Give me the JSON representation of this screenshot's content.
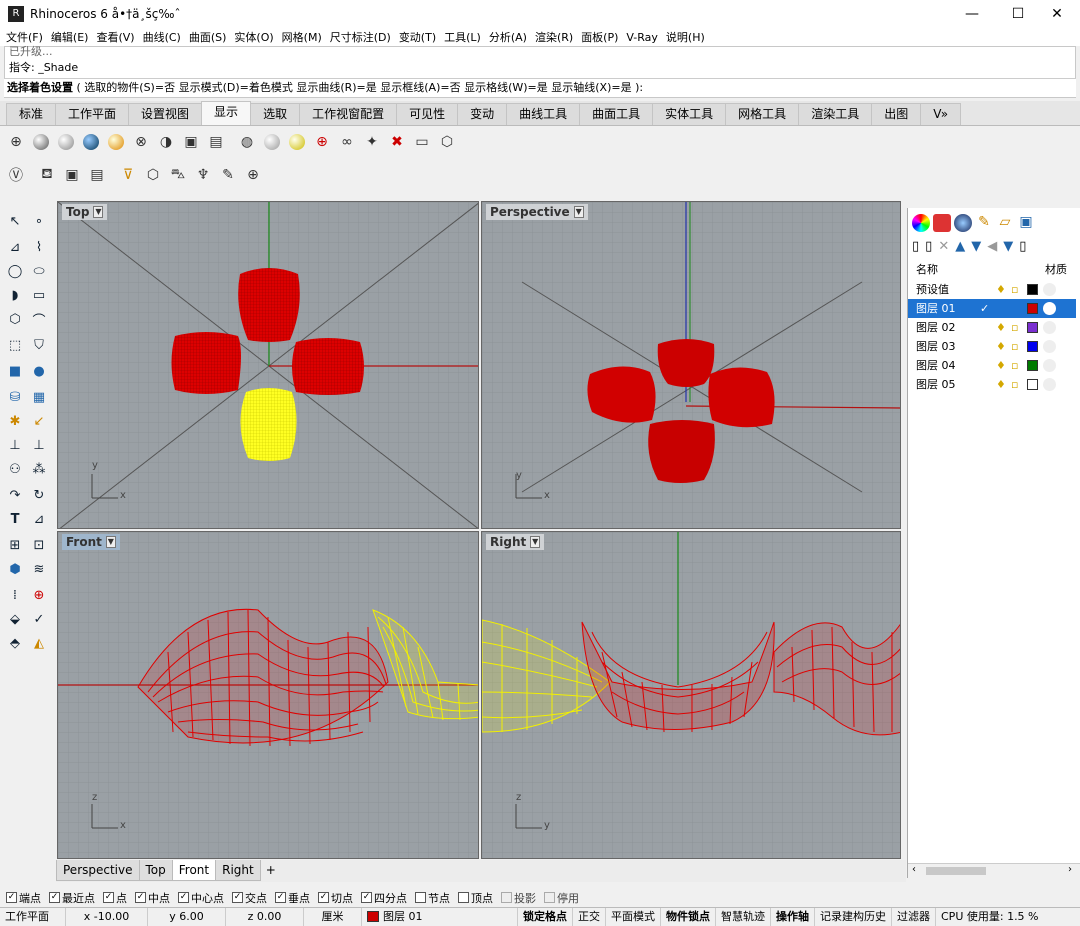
{
  "window": {
    "title": "Rhinoceros 6 å•†ä¸šç‰ˆ",
    "min": "—",
    "max": "☐",
    "close": "✕"
  },
  "menu": [
    "文件(F)",
    "编辑(E)",
    "查看(V)",
    "曲线(C)",
    "曲面(S)",
    "实体(O)",
    "网格(M)",
    "尺寸标注(D)",
    "变动(T)",
    "工具(L)",
    "分析(A)",
    "渲染(R)",
    "面板(P)",
    "V-Ray",
    "说明(H)"
  ],
  "command": {
    "history_partial": "已升级...",
    "history": "指令: _Shade",
    "prompt_label": "选择着色设置",
    "prompt_rest": " ( 选取的物件(S)=否  显示模式(D)=着色模式  显示曲线(R)=是  显示框线(A)=否  显示格线(W)=是  显示轴线(X)=是 ):"
  },
  "tabs": [
    "标准",
    "工作平面",
    "设置视图",
    "显示",
    "选取",
    "工作视窗配置",
    "可见性",
    "变动",
    "曲线工具",
    "曲面工具",
    "实体工具",
    "网格工具",
    "渲染工具",
    "出图",
    "V»"
  ],
  "active_tab": "显示",
  "viewports": {
    "top": {
      "label": "Top",
      "x": "x",
      "y": "y"
    },
    "perspective": {
      "label": "Perspective",
      "x": "x",
      "y": "y"
    },
    "front": {
      "label": "Front",
      "x": "x",
      "y": "z"
    },
    "right": {
      "label": "Right",
      "x": "y",
      "y": "z"
    }
  },
  "viewport_tabs": [
    "Perspective",
    "Top",
    "Front",
    "Right"
  ],
  "viewport_tabs_add": "+",
  "layers": {
    "header_name": "名称",
    "header_material": "材质",
    "rows": [
      {
        "name": "预设值",
        "color": "#000000"
      },
      {
        "name": "图层 01",
        "color": "#cc0000",
        "check": "✓"
      },
      {
        "name": "图层 02",
        "color": "#7a2fd0"
      },
      {
        "name": "图层 03",
        "color": "#0000ee"
      },
      {
        "name": "图层 04",
        "color": "#007a00"
      },
      {
        "name": "图层 05",
        "color": "#ffffff"
      }
    ]
  },
  "osnaps": [
    {
      "label": "端点",
      "on": true
    },
    {
      "label": "最近点",
      "on": true
    },
    {
      "label": "点",
      "on": true
    },
    {
      "label": "中点",
      "on": true
    },
    {
      "label": "中心点",
      "on": true
    },
    {
      "label": "交点",
      "on": true
    },
    {
      "label": "垂点",
      "on": true
    },
    {
      "label": "切点",
      "on": true
    },
    {
      "label": "四分点",
      "on": true
    },
    {
      "label": "节点",
      "on": false
    },
    {
      "label": "顶点",
      "on": false
    },
    {
      "label": "投影",
      "on": false,
      "disabled": true
    },
    {
      "label": "停用",
      "on": false,
      "disabled": true
    }
  ],
  "status": {
    "cplane": "工作平面",
    "x": "x -10.00",
    "y": "y 6.00",
    "z": "z 0.00",
    "units": "厘米",
    "layer": "图层 01",
    "layer_color": "#cc0000",
    "toggles": [
      {
        "label": "锁定格点",
        "bold": true
      },
      {
        "label": "正交",
        "bold": false
      },
      {
        "label": "平面模式",
        "bold": false
      },
      {
        "label": "物件锁点",
        "bold": true
      },
      {
        "label": "智慧轨迹",
        "bold": false
      },
      {
        "label": "操作轴",
        "bold": true
      },
      {
        "label": "记录建构历史",
        "bold": false
      },
      {
        "label": "过滤器",
        "bold": false
      }
    ],
    "cpu": "CPU 使用量: 1.5 %"
  }
}
